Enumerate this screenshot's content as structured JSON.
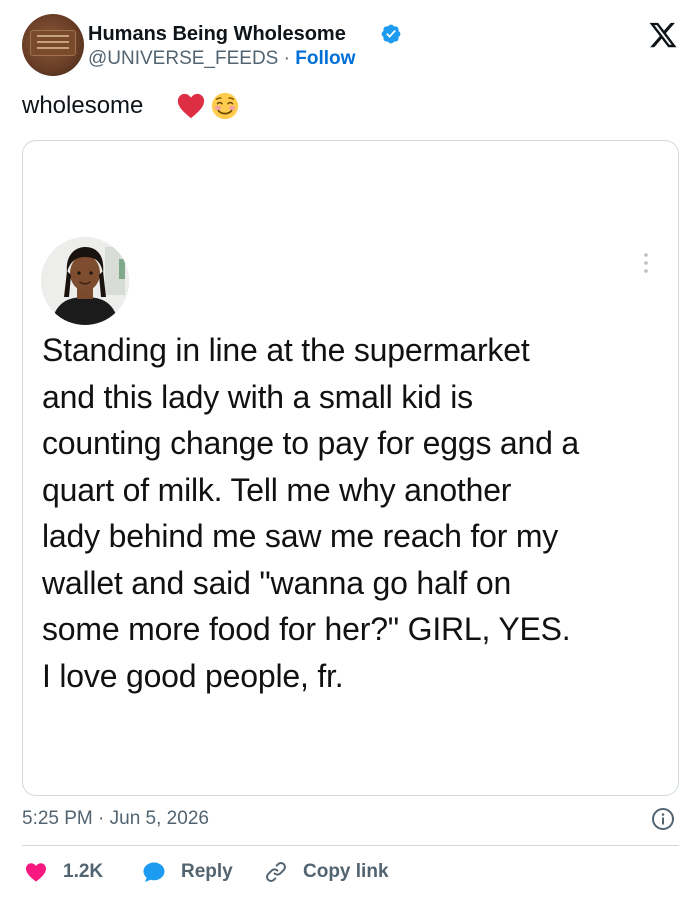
{
  "author": {
    "display_name": "Humans Being Wholesome",
    "handle": "@UNIVERSE_FEEDS",
    "separator": "·",
    "follow_label": "Follow",
    "verified": true
  },
  "caption": {
    "text": "wholesome",
    "emojis": [
      "red-heart",
      "smiling-face-with-blush"
    ]
  },
  "embedded_post": {
    "lines": [
      "Standing in line at the supermarket",
      "and this lady with a small kid is",
      "counting change to pay for eggs and a",
      "quart of milk. Tell me why another",
      "lady behind me saw me reach for my",
      "wallet and said \"wanna go half on",
      "some more food for her?\" GIRL, YES.",
      "I love good people, fr."
    ]
  },
  "meta": {
    "timestamp": "5:25 PM · Jun 5, 2026"
  },
  "actions": {
    "like_count": "1.2K",
    "reply_label": "Reply",
    "copy_label": "Copy link"
  },
  "colors": {
    "accent": "#006fd6",
    "like": "#f91880",
    "reply": "#1d9bf0",
    "muted": "#536471",
    "border": "#cfd9de"
  },
  "icons": [
    "x-logo-icon",
    "verified-badge-icon",
    "more-dots-icon",
    "info-icon",
    "heart-icon",
    "reply-bubble-icon",
    "link-icon"
  ]
}
